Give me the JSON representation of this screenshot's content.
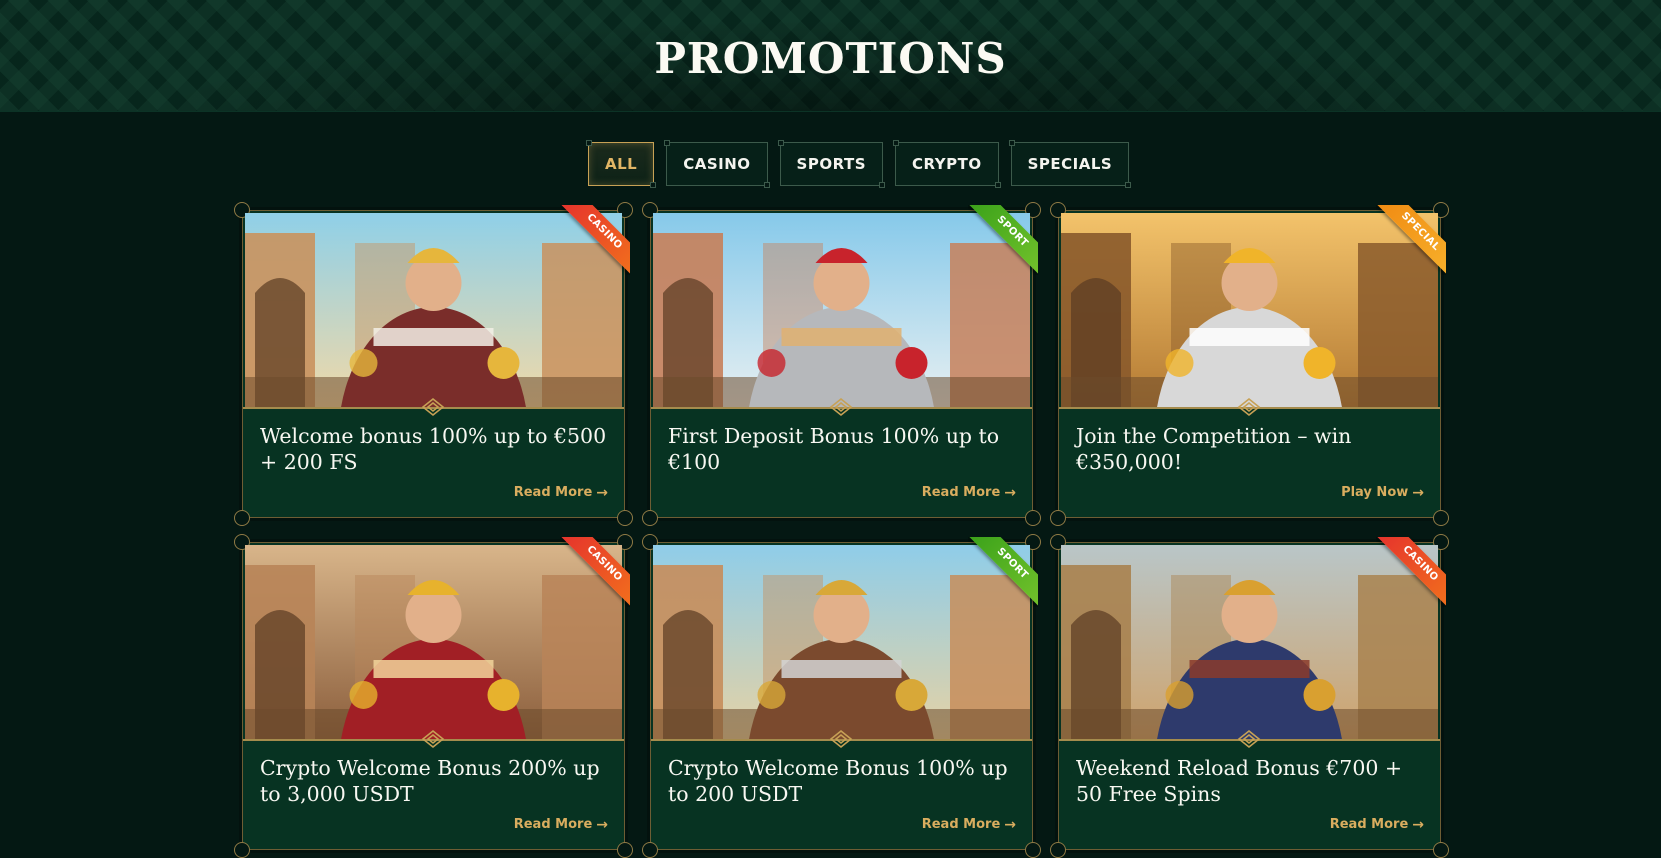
{
  "page": {
    "title": "PROMOTIONS"
  },
  "filters": [
    {
      "label": "ALL",
      "active": true
    },
    {
      "label": "CASINO",
      "active": false
    },
    {
      "label": "SPORTS",
      "active": false
    },
    {
      "label": "CRYPTO",
      "active": false
    },
    {
      "label": "SPECIALS",
      "active": false
    }
  ],
  "promotions": [
    {
      "tag": "CASINO",
      "tag_style": "casino",
      "title": "Welcome bonus 100% up to €500 + 200 FS",
      "cta": "Read More",
      "scene": "king"
    },
    {
      "tag": "SPORT",
      "tag_style": "sport",
      "title": "First Deposit Bonus 100% up to €100",
      "cta": "Read More",
      "scene": "gladiator"
    },
    {
      "tag": "SPECIAL",
      "tag_style": "special",
      "title": "Join the Competition – win €350,000!",
      "cta": "Play Now",
      "scene": "knight"
    },
    {
      "tag": "CASINO",
      "tag_style": "casino",
      "title": "Crypto Welcome Bonus 200% up to 3,000 USDT",
      "cta": "Read More",
      "scene": "queen"
    },
    {
      "tag": "SPORT",
      "tag_style": "sport",
      "title": "Crypto Welcome Bonus 100% up to 200 USDT",
      "cta": "Read More",
      "scene": "trophy"
    },
    {
      "tag": "CASINO",
      "tag_style": "casino",
      "title": "Weekend Reload Bonus €700 + 50 Free Spins",
      "cta": "Read More",
      "scene": "heroine"
    }
  ],
  "colors": {
    "background": "#041813",
    "card": "#073322",
    "gold": "#d9ad5f",
    "casino_ribbon": "#e5322d",
    "sport_ribbon": "#3aa11a",
    "special_ribbon": "#f08a12"
  },
  "icons": {
    "cta_arrow": "arrow-right-icon",
    "divider": "celtic-knot-icon"
  }
}
